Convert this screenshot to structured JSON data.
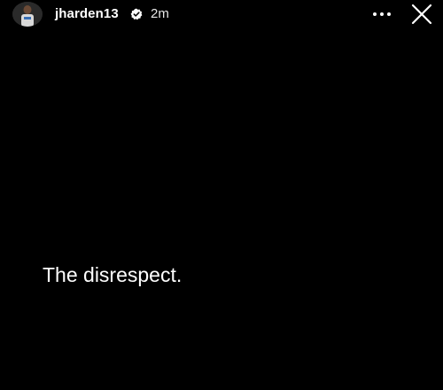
{
  "story": {
    "username": "jharden13",
    "verified": true,
    "timestamp": "2m",
    "text": "The disrespect.",
    "background_color": "#000000",
    "text_color": "#ffffff"
  },
  "icons": {
    "avatar": "profile-avatar",
    "verified": "verified-badge-icon",
    "more": "more-options-icon",
    "close": "close-icon"
  }
}
